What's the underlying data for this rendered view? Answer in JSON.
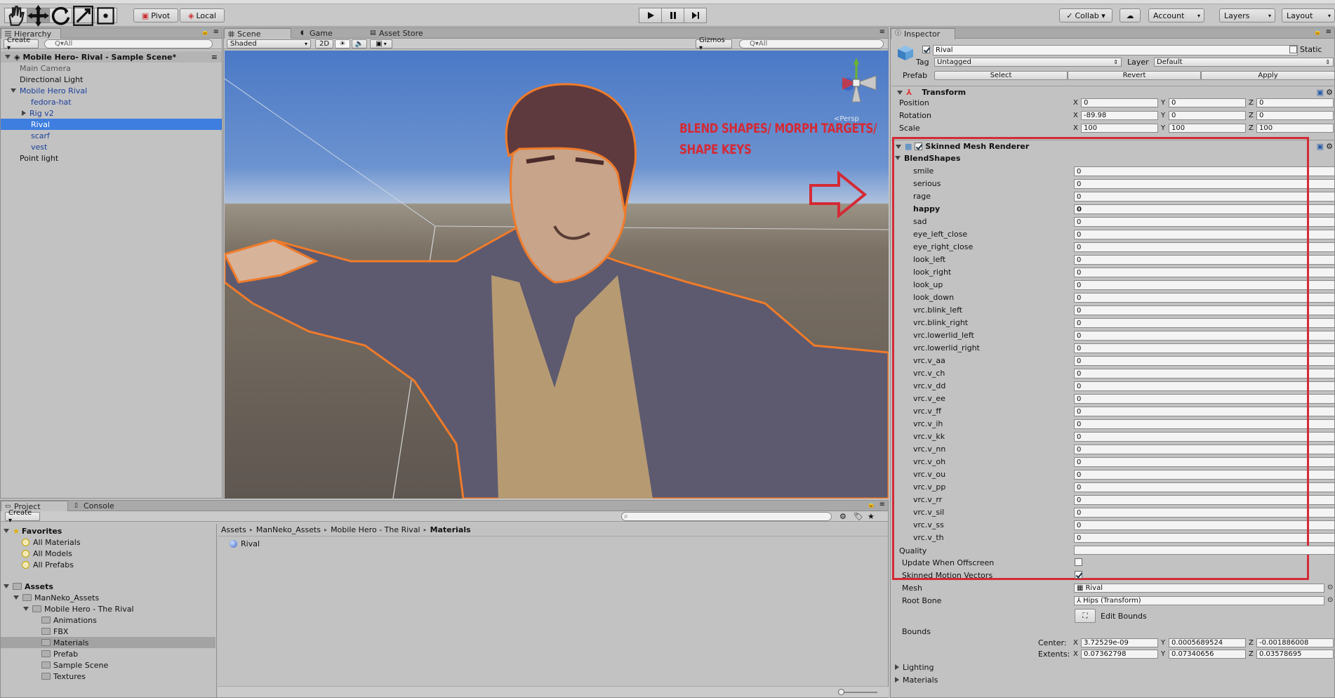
{
  "toolbar": {
    "pivot": "Pivot",
    "local": "Local",
    "collab": "Collab ▾",
    "account": "Account",
    "layers": "Layers",
    "layout": "Layout"
  },
  "hierarchy": {
    "tab": "Hierarchy",
    "create": "Create ▾",
    "search_placeholder": "Q▾All",
    "scene_name": "Mobile Hero- Rival - Sample Scene*",
    "items": [
      {
        "label": "Main Camera",
        "indent": 1,
        "style": "gray"
      },
      {
        "label": "Directional Light",
        "indent": 1,
        "style": "normal"
      },
      {
        "label": "Mobile Hero Rival",
        "indent": 1,
        "style": "blue",
        "fold": "down"
      },
      {
        "label": "fedora-hat",
        "indent": 2,
        "style": "blue"
      },
      {
        "label": "Rig v2",
        "indent": 2,
        "style": "blue",
        "fold": "right"
      },
      {
        "label": "Rival",
        "indent": 2,
        "style": "selected"
      },
      {
        "label": "scarf",
        "indent": 2,
        "style": "blue"
      },
      {
        "label": "vest",
        "indent": 2,
        "style": "blue"
      },
      {
        "label": "Point light",
        "indent": 1,
        "style": "normal"
      }
    ]
  },
  "scene": {
    "tabs": [
      "Scene",
      "Game",
      "Asset Store"
    ],
    "shading": "Shaded",
    "mode_2d": "2D",
    "gizmos": "Gizmos ▾",
    "search_placeholder": "Q▾All",
    "persp": "<Persp",
    "annotation_line1": "BLEND SHAPES/ MORPH TARGETS/",
    "annotation_line2": "SHAPE KEYS",
    "annotation_color": "#d42a35"
  },
  "inspector": {
    "tab": "Inspector",
    "object_name": "Rival",
    "static": "Static",
    "tag_label": "Tag",
    "tag_value": "Untagged",
    "layer_label": "Layer",
    "layer_value": "Default",
    "prefab_label": "Prefab",
    "prefab_select": "Select",
    "prefab_revert": "Revert",
    "prefab_apply": "Apply",
    "transform": {
      "title": "Transform",
      "position": {
        "label": "Position",
        "x": "0",
        "y": "0",
        "z": "0"
      },
      "rotation": {
        "label": "Rotation",
        "x": "-89.98",
        "y": "0",
        "z": "0"
      },
      "scale": {
        "label": "Scale",
        "x": "100",
        "y": "100",
        "z": "100"
      }
    },
    "smr": {
      "title": "Skinned Mesh Renderer",
      "blendshapes_title": "BlendShapes",
      "blendshapes": [
        {
          "name": "smile",
          "value": "0"
        },
        {
          "name": "serious",
          "value": "0"
        },
        {
          "name": "rage",
          "value": "0"
        },
        {
          "name": "happy",
          "value": "0",
          "bold": true
        },
        {
          "name": "sad",
          "value": "0"
        },
        {
          "name": "eye_left_close",
          "value": "0"
        },
        {
          "name": "eye_right_close",
          "value": "0"
        },
        {
          "name": "look_left",
          "value": "0"
        },
        {
          "name": "look_right",
          "value": "0"
        },
        {
          "name": "look_up",
          "value": "0"
        },
        {
          "name": "look_down",
          "value": "0"
        },
        {
          "name": "vrc.blink_left",
          "value": "0"
        },
        {
          "name": "vrc.blink_right",
          "value": "0"
        },
        {
          "name": "vrc.lowerlid_left",
          "value": "0"
        },
        {
          "name": "vrc.lowerlid_right",
          "value": "0"
        },
        {
          "name": "vrc.v_aa",
          "value": "0"
        },
        {
          "name": "vrc.v_ch",
          "value": "0"
        },
        {
          "name": "vrc.v_dd",
          "value": "0"
        },
        {
          "name": "vrc.v_ee",
          "value": "0"
        },
        {
          "name": "vrc.v_ff",
          "value": "0"
        },
        {
          "name": "vrc.v_ih",
          "value": "0"
        },
        {
          "name": "vrc.v_kk",
          "value": "0"
        },
        {
          "name": "vrc.v_nn",
          "value": "0"
        },
        {
          "name": "vrc.v_oh",
          "value": "0"
        },
        {
          "name": "vrc.v_ou",
          "value": "0"
        },
        {
          "name": "vrc.v_pp",
          "value": "0"
        },
        {
          "name": "vrc.v_rr",
          "value": "0"
        },
        {
          "name": "vrc.v_sil",
          "value": "0"
        },
        {
          "name": "vrc.v_ss",
          "value": "0"
        },
        {
          "name": "vrc.v_th",
          "value": "0"
        }
      ],
      "quality_label": "Quality",
      "update_offscreen": "Update When Offscreen",
      "skinned_motion": "Skinned Motion Vectors",
      "mesh_label": "Mesh",
      "mesh_value": "Rival",
      "root_bone_label": "Root Bone",
      "root_bone_value": "Hips (Transform)",
      "edit_bounds": "Edit Bounds",
      "bounds_label": "Bounds",
      "center_label": "Center:",
      "center": {
        "x": "3.72529e-09",
        "y": "0.0005689524",
        "z": "-0.001886008"
      },
      "extents_label": "Extents:",
      "extents": {
        "x": "0.07362798",
        "y": "0.07340656",
        "z": "0.03578695"
      },
      "lighting": "Lighting",
      "materials": "Materials"
    },
    "highlight_color": "#d42a35"
  },
  "project": {
    "tabs": [
      "Project",
      "Console"
    ],
    "create": "Create ▾",
    "favorites_title": "Favorites",
    "favorites": [
      "All Materials",
      "All Models",
      "All Prefabs"
    ],
    "assets_title": "Assets",
    "tree": [
      {
        "label": "ManNeko_Assets",
        "indent": 1,
        "fold": "down"
      },
      {
        "label": "Mobile Hero - The Rival",
        "indent": 2,
        "fold": "down"
      },
      {
        "label": "Animations",
        "indent": 3
      },
      {
        "label": "FBX",
        "indent": 3
      },
      {
        "label": "Materials",
        "indent": 3,
        "selected": true
      },
      {
        "label": "Prefab",
        "indent": 3
      },
      {
        "label": "Sample Scene",
        "indent": 3
      },
      {
        "label": "Textures",
        "indent": 3
      }
    ],
    "breadcrumb": [
      "Assets",
      "ManNeko_Assets",
      "Mobile Hero - The Rival",
      "Materials"
    ],
    "files": [
      "Rival"
    ]
  }
}
